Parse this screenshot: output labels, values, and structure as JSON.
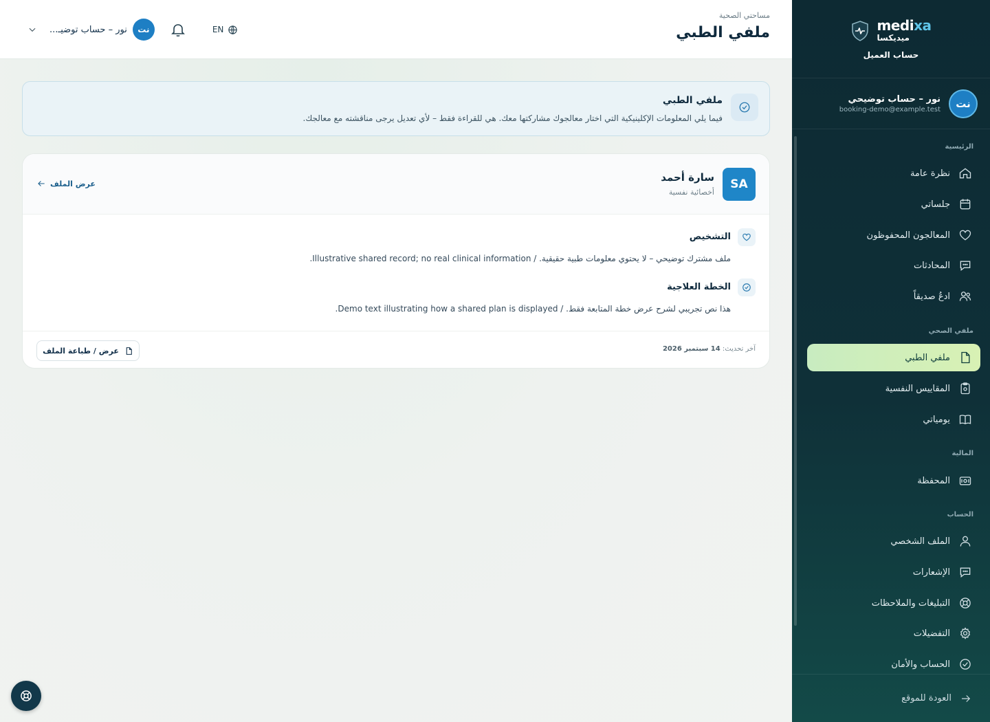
{
  "brand": {
    "name_en_main": "medi",
    "name_en_accent": "xa",
    "name_ar": "ميديكسا",
    "account_label": "حساب العميل",
    "accent_color": "#5fc4e8"
  },
  "user": {
    "initials": "نت",
    "name": "نور – حساب توضيحي",
    "email": "booking-demo@example.test",
    "chip_name": "نور – حساب توضيـ..."
  },
  "sidebar": {
    "sections": [
      {
        "title": "الرئيسية"
      },
      {
        "title": "ملفي الصحي"
      },
      {
        "title": "المالية"
      },
      {
        "title": "الحساب"
      }
    ],
    "items": [
      {
        "label": "نظرة عامة",
        "icon": "home-icon"
      },
      {
        "label": "جلساتي",
        "icon": "calendar-icon"
      },
      {
        "label": "المعالجون المحفوظون",
        "icon": "heart-icon"
      },
      {
        "label": "المحادثات",
        "icon": "chat-icon"
      },
      {
        "label": "ادعُ صديقاً",
        "icon": "users-icon"
      },
      {
        "label": "ملفي الطبي",
        "icon": "file-icon",
        "active": true
      },
      {
        "label": "المقاييس النفسية",
        "icon": "clipboard-icon"
      },
      {
        "label": "يومياتي",
        "icon": "book-icon"
      },
      {
        "label": "المحفظة",
        "icon": "wallet-icon"
      },
      {
        "label": "الملف الشخصي",
        "icon": "user-icon"
      },
      {
        "label": "الإشعارات",
        "icon": "message-icon"
      },
      {
        "label": "التبليغات والملاحظات",
        "icon": "lifebuoy-icon"
      },
      {
        "label": "التفضيلات",
        "icon": "gear-icon"
      },
      {
        "label": "الحساب والأمان",
        "icon": "check-circle-icon"
      }
    ],
    "back_label": "العودة للموقع",
    "active_color": "#d8f1b4"
  },
  "header": {
    "breadcrumb": "مساحتي الصحية",
    "title": "ملفي الطبي",
    "language": "EN"
  },
  "banner": {
    "title": "ملفي الطبي",
    "text": "فيما يلي المعلومات الإكلينيكية التي اختار معالجوك مشاركتها معك. هي للقراءة فقط – لأي تعديل يرجى مناقشته مع معالجك."
  },
  "record": {
    "initials": "SA",
    "therapist_name": "سارة أحمد",
    "therapist_role": "أخصائية نفسية",
    "view_profile": "عرض الملف",
    "sections": [
      {
        "title": "التشخيص",
        "icon": "heart-icon",
        "body": "ملف مشترك توضيحي – لا يحتوي معلومات طبية حقيقية. / Illustrative shared record; no real clinical information."
      },
      {
        "title": "الخطة العلاجية",
        "icon": "check-circle-icon",
        "body": "هذا نص تجريبي لشرح عرض خطة المتابعة فقط. / Demo text illustrating how a shared plan is displayed."
      }
    ],
    "updated_prefix": "آخر تحديث:",
    "updated_date": "14 سبتمبر 2026",
    "print_label": "عرض / طباعة الملف"
  }
}
